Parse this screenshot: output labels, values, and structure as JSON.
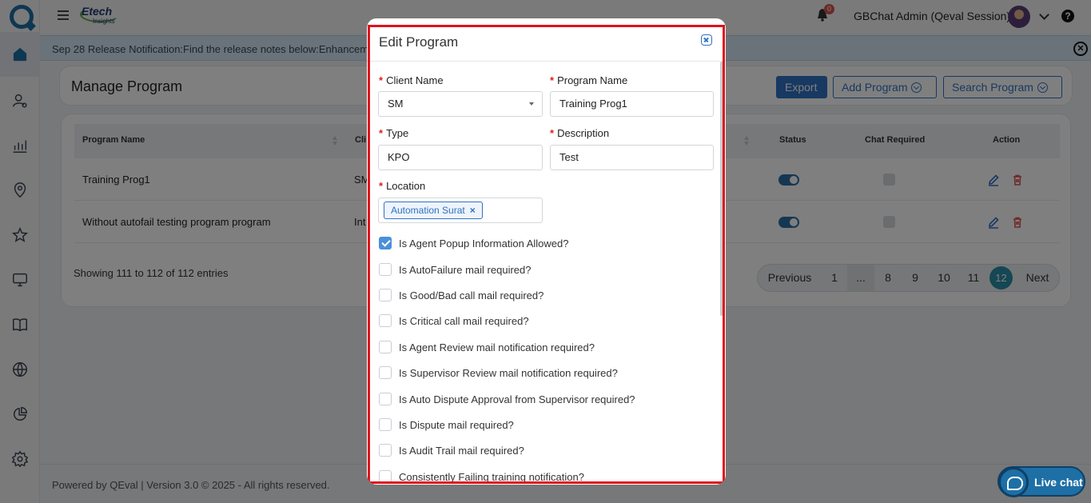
{
  "header": {
    "brand_top": "Etech",
    "brand_bottom": "Insights",
    "notification_count": "0",
    "user_name": "GBChat Admin (Qeval Session)",
    "help_glyph": "?"
  },
  "notification": {
    "text": "Sep 28 Release Notification:Find the release notes below:Enhancem"
  },
  "page": {
    "title": "Manage Program",
    "export_label": "Export",
    "add_label": "Add Program",
    "search_label": "Search Program"
  },
  "table": {
    "columns": [
      "Program Name",
      "Cli",
      "Status",
      "Chat Required",
      "Action"
    ],
    "rows": [
      {
        "program_name": "Training Prog1",
        "client": "SM"
      },
      {
        "program_name": "Without autofail testing program program",
        "client": "Int"
      }
    ],
    "showing": "Showing 111 to 112 of 112 entries"
  },
  "pagination": {
    "previous": "Previous",
    "pages": [
      "1",
      "...",
      "8",
      "9",
      "10",
      "11",
      "12"
    ],
    "active": "12",
    "next": "Next"
  },
  "footer": {
    "text": "Powered by QEval | Version 3.0 © 2025 - All rights reserved.",
    "live_chat": "Live chat"
  },
  "modal": {
    "title": "Edit Program",
    "required_mark": "*",
    "client_name_label": "Client Name",
    "client_name_value": "SM",
    "program_name_label": "Program Name",
    "program_name_value": "Training Prog1",
    "type_label": "Type",
    "type_value": "KPO",
    "description_label": "Description",
    "description_value": "Test",
    "location_label": "Location",
    "location_tag": "Automation Surat",
    "tag_remove": "×",
    "options": [
      {
        "label": "Is Agent Popup Information Allowed?",
        "checked": true
      },
      {
        "label": "Is AutoFailure mail required?",
        "checked": false
      },
      {
        "label": "Is Good/Bad call mail required?",
        "checked": false
      },
      {
        "label": "Is Critical call mail required?",
        "checked": false
      },
      {
        "label": "Is Agent Review mail notification required?",
        "checked": false
      },
      {
        "label": "Is Supervisor Review mail notification required?",
        "checked": false
      },
      {
        "label": "Is Auto Dispute Approval from Supervisor required?",
        "checked": false
      },
      {
        "label": "Is Dispute mail required?",
        "checked": false
      },
      {
        "label": "Is Audit Trail mail required?",
        "checked": false
      },
      {
        "label": "Consistently Failing training notification?",
        "checked": false
      }
    ]
  },
  "colors": {
    "primary": "#2f72c4",
    "toggle_on": "#2c6fa4",
    "active_page": "#2b8fa8",
    "highlight_border": "#e0121d",
    "delete": "#d9534f"
  }
}
